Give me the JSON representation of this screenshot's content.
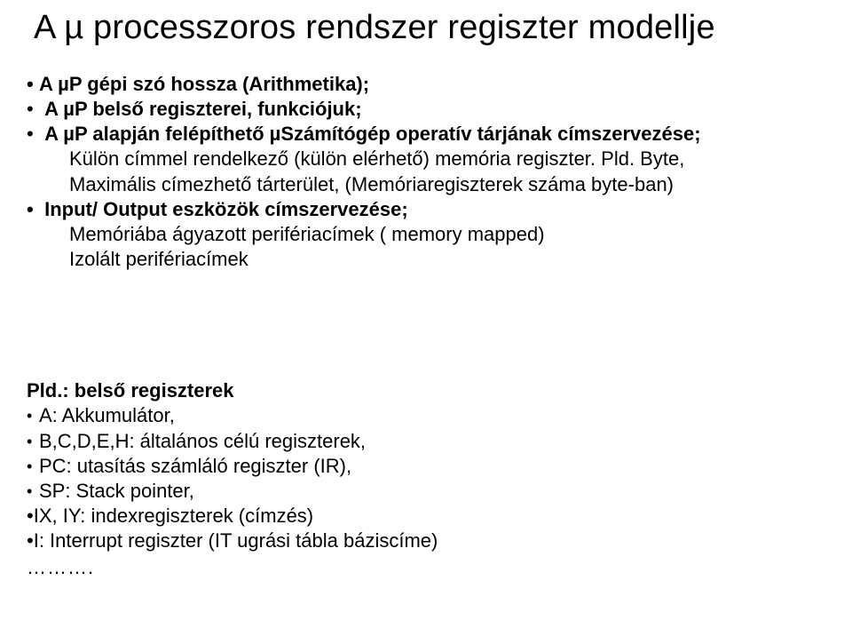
{
  "title": "A µ processzoros rendszer regiszter modellje",
  "section1": {
    "l1": "A µP gépi szó hossza (Arithmetika);",
    "l2": "A µP belső regiszterei, funkciójuk;",
    "l3a": "A µP alapján felépíthető ",
    "l3b": "µSzámítógép",
    "l3c": " operatív tárjának címszervezése;",
    "l4": "Külön címmel rendelkező (külön elérhető) memória regiszter. Pld. Byte,",
    "l5": "Maximális címezhető tárterület, (Memóriaregiszterek száma byte-ban)",
    "l6": "Input/ Output eszközök címszervezése;",
    "l7": "Memóriába ágyazott perifériacímek ( memory mapped)",
    "l8": "Izolált perifériacímek"
  },
  "section2": {
    "header": "Pld.: belső regiszterek",
    "i1": "A: Akkumulátor,",
    "i2": "B,C,D,E,H: általános célú regiszterek,",
    "i3": "PC: utasítás számláló regiszter (IR),",
    "i4": "SP: Stack pointer,",
    "i5": "IX, IY: indexregiszterek (címzés)",
    "i6": "I: Interrupt regiszter (IT ugrási tábla báziscíme)",
    "ellipsis": "………."
  }
}
